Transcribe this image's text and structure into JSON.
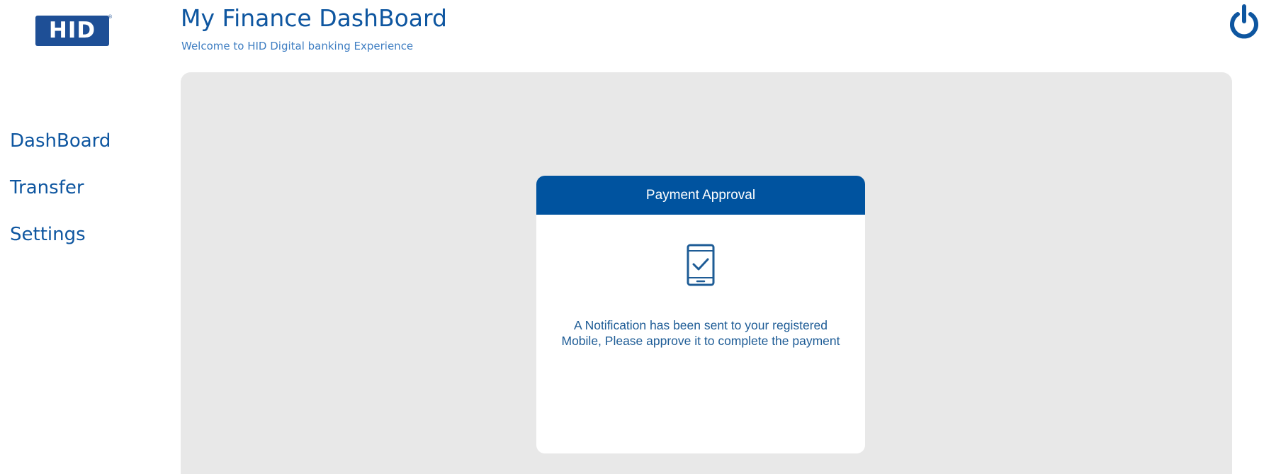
{
  "logo": {
    "text": "HID",
    "registered_mark": "®"
  },
  "header": {
    "title": "My Finance DashBoard",
    "subtitle": "Welcome to HID Digital banking Experience",
    "power_icon": "power-icon"
  },
  "sidebar": {
    "items": [
      {
        "label": "DashBoard"
      },
      {
        "label": "Transfer"
      },
      {
        "label": "Settings"
      }
    ]
  },
  "approval_card": {
    "title": "Payment Approval",
    "icon": "mobile-check-icon",
    "message": "A Notification has been sent to your registered Mobile, Please approve it to complete the payment"
  },
  "colors": {
    "brand_blue": "#00539f",
    "text_blue": "#0e56a0",
    "panel_gray": "#e8e8e8"
  }
}
